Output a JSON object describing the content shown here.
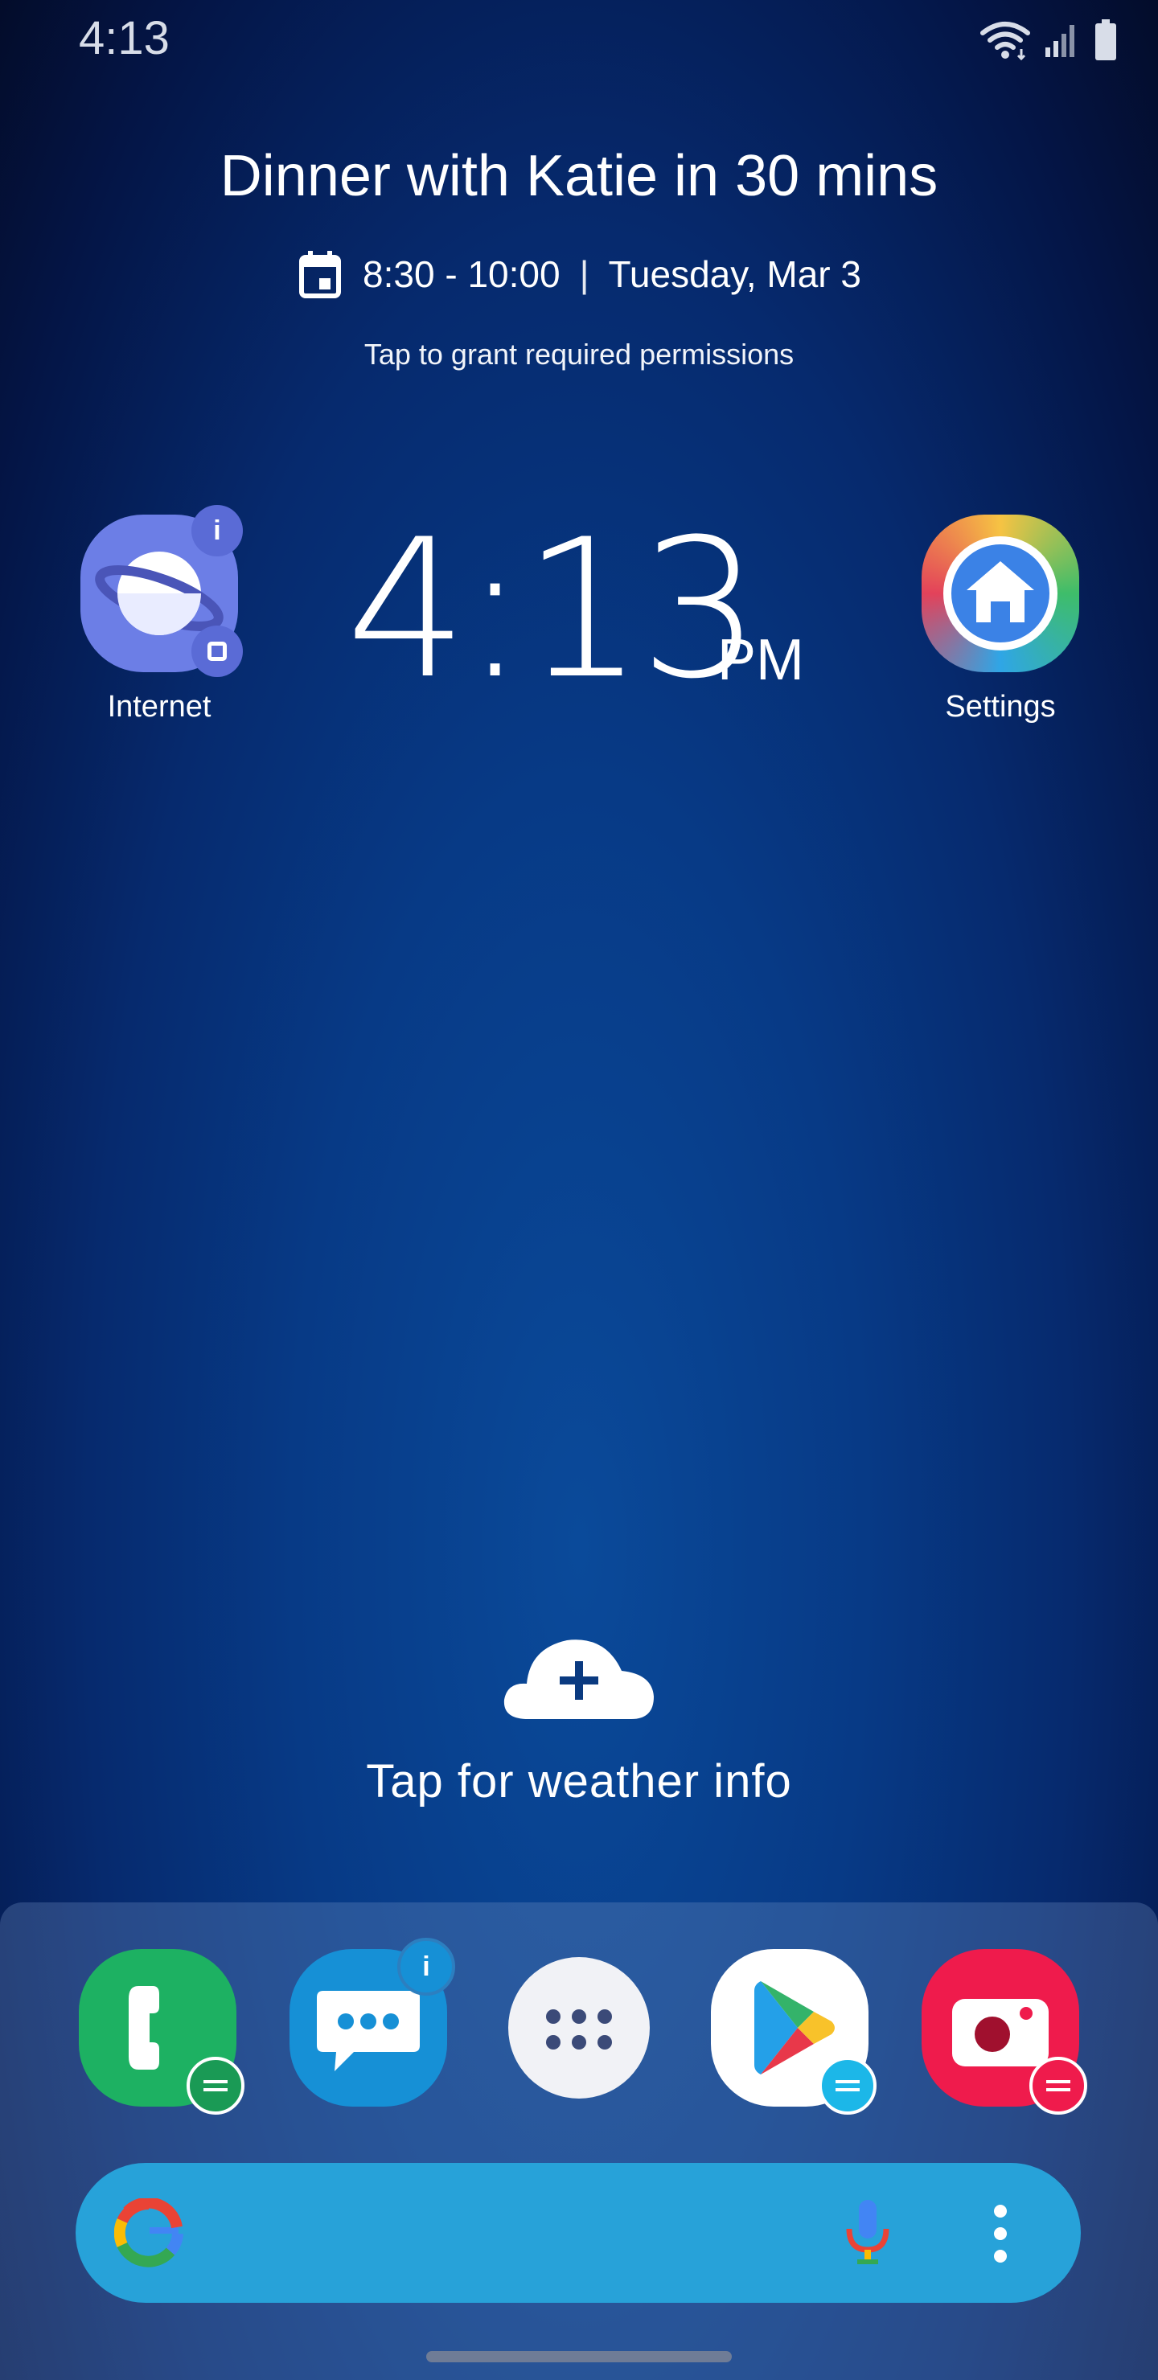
{
  "status_bar": {
    "time": "4:13"
  },
  "event": {
    "title": "Dinner with Katie in 30 mins",
    "time_range": "8:30 - 10:00",
    "separator": "|",
    "date": "Tuesday, Mar 3",
    "hint": "Tap to grant required permissions"
  },
  "clock": {
    "time": "4:13",
    "ampm": "PM"
  },
  "apps": {
    "internet": {
      "label": "Internet",
      "badge": "i"
    },
    "settings": {
      "label": "Settings"
    }
  },
  "weather": {
    "text": "Tap for weather info"
  },
  "dock": {
    "messages_badge": "i",
    "apps": [
      "phone-app",
      "messages-app",
      "app-drawer",
      "play-store-app",
      "camera-app"
    ]
  },
  "colors": {
    "phone": "#1db162",
    "messages": "#1690d6",
    "camera": "#ef1b4c",
    "internet": "#6c7ee6",
    "search_bar": "#27a2d9"
  }
}
